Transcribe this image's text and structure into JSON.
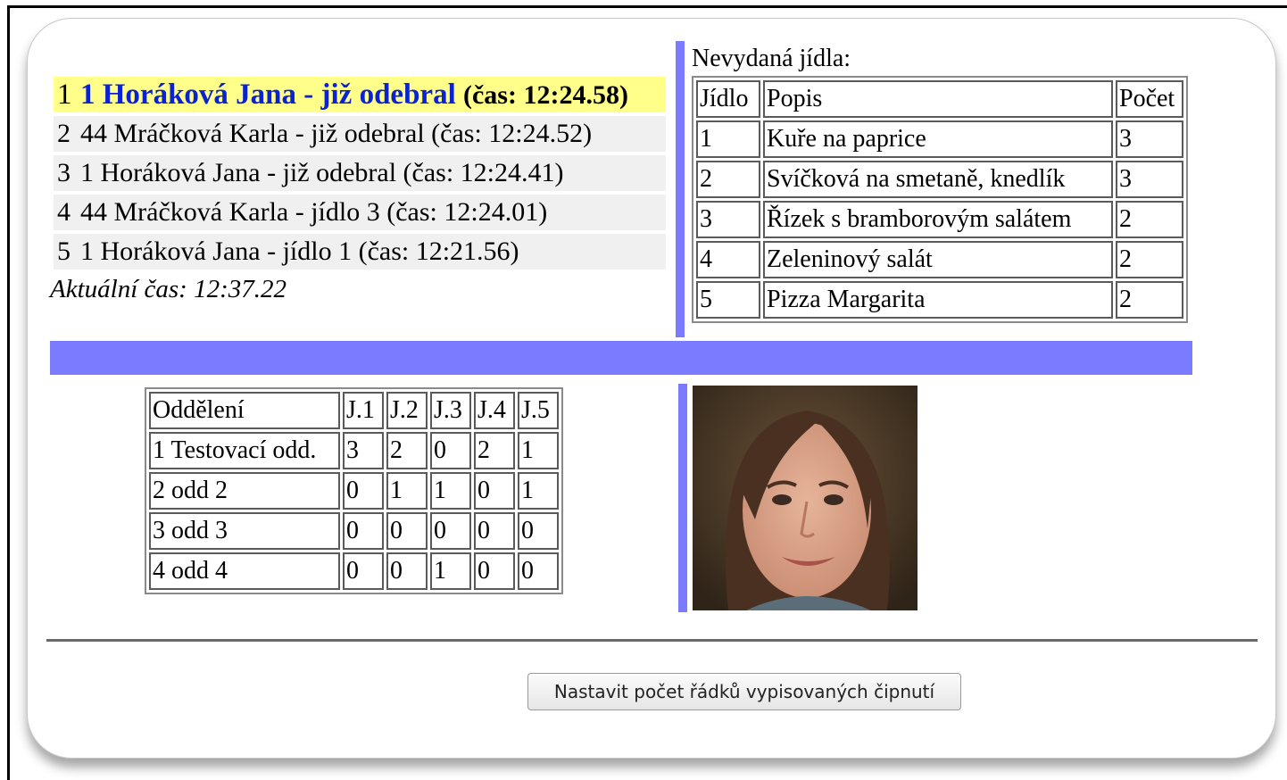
{
  "chips": [
    {
      "index": "1",
      "name": "1 Horáková Jana - již odebral",
      "time": "(čas: 12:24.58)",
      "active": true
    },
    {
      "index": "2",
      "text": "44 Mráčková Karla - již odebral (čas: 12:24.52)"
    },
    {
      "index": "3",
      "text": "1 Horáková Jana - již odebral (čas: 12:24.41)"
    },
    {
      "index": "4",
      "text": "44 Mráčková Karla - jídlo 3 (čas: 12:24.01)"
    },
    {
      "index": "5",
      "text": "1 Horáková Jana - jídlo 1 (čas: 12:21.56)"
    }
  ],
  "current_time": "Aktuální čas: 12:37.22",
  "meals": {
    "label": "Nevydaná jídla:",
    "headers": [
      "Jídlo",
      "Popis",
      "Počet"
    ],
    "rows": [
      [
        "1",
        "Kuře na paprice",
        "3"
      ],
      [
        "2",
        "Svíčková na smetaně, knedlík",
        "3"
      ],
      [
        "3",
        "Řízek s bramborovým salátem",
        "2"
      ],
      [
        "4",
        "Zeleninový salát",
        "2"
      ],
      [
        "5",
        "Pizza Margarita",
        "2"
      ]
    ]
  },
  "departments": {
    "headers": [
      "Oddělení",
      "J.1",
      "J.2",
      "J.3",
      "J.4",
      "J.5"
    ],
    "rows": [
      [
        "1 Testovací odd.",
        "3",
        "2",
        "0",
        "2",
        "1"
      ],
      [
        "2 odd 2",
        "0",
        "1",
        "1",
        "0",
        "1"
      ],
      [
        "3 odd 3",
        "0",
        "0",
        "0",
        "0",
        "0"
      ],
      [
        "4 odd 4",
        "0",
        "0",
        "1",
        "0",
        "0"
      ]
    ]
  },
  "photo": {
    "subject": "portrait of a smiling woman with long brown hair"
  },
  "button_label": "Nastavit počet řádků vypisovaných čipnutí",
  "colors": {
    "accent_bar": "#7b7bff",
    "highlight": "#ffff8a",
    "active_name": "#0a22d6",
    "row_bg": "#f0f0f0"
  }
}
